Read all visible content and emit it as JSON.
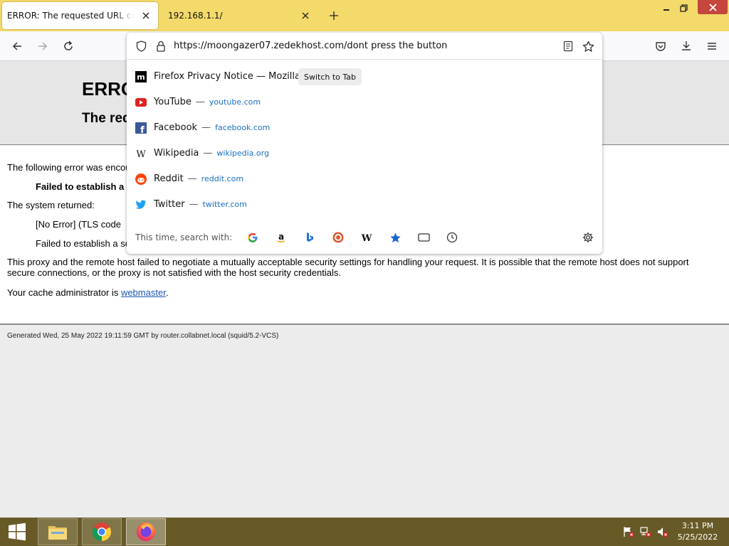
{
  "browser": {
    "tabs": [
      {
        "title": "ERROR: The requested URL could not be retrieved",
        "active": true
      },
      {
        "title": "192.168.1.1/",
        "active": false
      }
    ],
    "address": {
      "url": "https://moongazer07.zedekhost.com/dont press the button"
    }
  },
  "dropdown": {
    "suggestions": [
      {
        "title": "Firefox Privacy Notice — Mozilla",
        "action": "Switch to Tab",
        "icon": "mozilla-icon"
      },
      {
        "title": "YouTube",
        "sep": "—",
        "url": "youtube.com",
        "icon": "youtube-icon"
      },
      {
        "title": "Facebook",
        "sep": "—",
        "url": "facebook.com",
        "icon": "facebook-icon"
      },
      {
        "title": "Wikipedia",
        "sep": "—",
        "url": "wikipedia.org",
        "icon": "wikipedia-icon"
      },
      {
        "title": "Reddit",
        "sep": "—",
        "url": "reddit.com",
        "icon": "reddit-icon"
      },
      {
        "title": "Twitter",
        "sep": "—",
        "url": "twitter.com",
        "icon": "twitter-icon"
      }
    ],
    "search_label": "This time, search with:",
    "search_engines": [
      "google-icon",
      "amazon-icon",
      "bing-icon",
      "duckduckgo-icon",
      "wikipedia-icon",
      "bookmarks-icon",
      "tabs-icon",
      "history-icon"
    ]
  },
  "page": {
    "title": "ERROR",
    "subtitle": "The requested URL could not be retrieved",
    "intro": "The following error was encountered while trying to retrieve the URL:",
    "failed_bold": "Failed to establish a secure connection to",
    "system_returned": "The system returned:",
    "error_code": "[No Error] (TLS code",
    "failed_plain": "Failed to establish a secure connection",
    "paragraph": "This proxy and the remote host failed to negotiate a mutually acceptable security settings for handling your request. It is possible that the remote host does not support secure connections, or the proxy is not satisfied with the host security credentials.",
    "admin_prefix": "Your cache administrator is ",
    "admin_link": "webmaster",
    "admin_suffix": ".",
    "footer": "Generated Wed, 25 May 2022 19:11:59 GMT by router.collabnet.local (squid/5.2-VCS)"
  },
  "taskbar": {
    "time": "3:11 PM",
    "date": "5/25/2022"
  },
  "colors": {
    "titlebar": "#f3da6a",
    "taskbar": "#685a27",
    "link": "#1a6fbf"
  }
}
